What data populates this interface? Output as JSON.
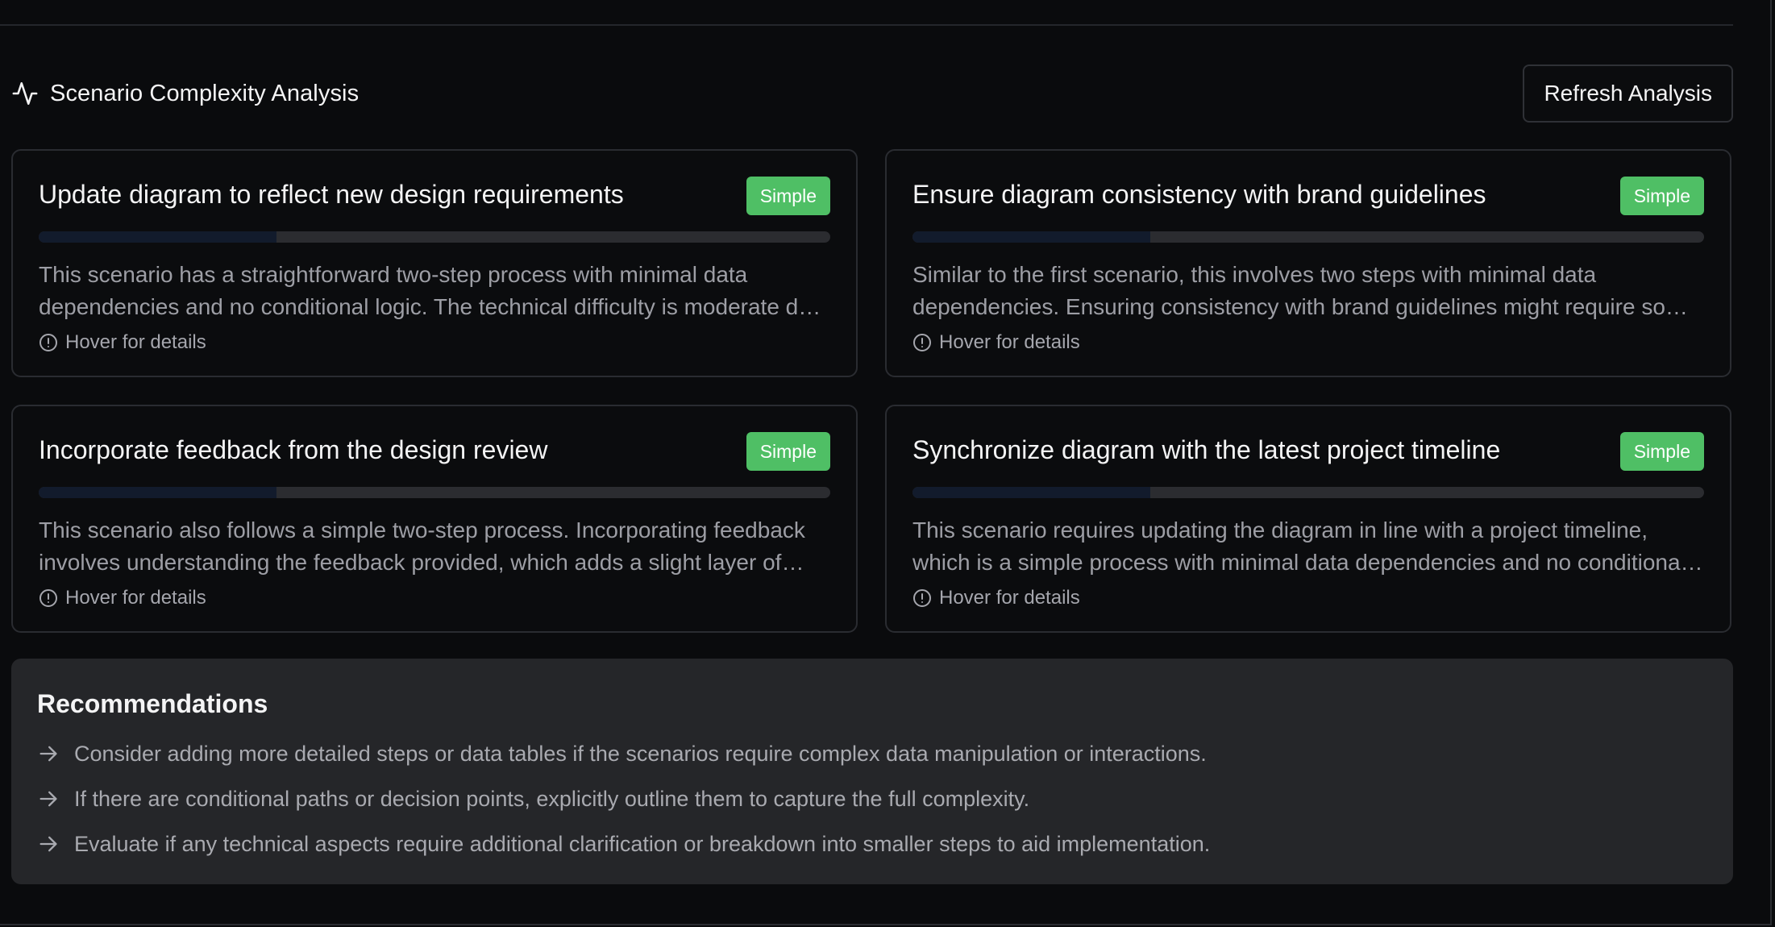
{
  "header": {
    "title": "Scenario Complexity Analysis",
    "refresh_label": "Refresh Analysis",
    "icon": "activity-icon"
  },
  "scenarios": [
    {
      "title": "Update diagram to reflect new design requirements",
      "badge": "Simple",
      "complexity_fraction": 0.3,
      "description": "This scenario has a straightforward two-step process with minimal data dependencies and no conditional logic. The technical difficulty is moderate due to the need for interpreting new design requirements.",
      "hover_label": "Hover for details"
    },
    {
      "title": "Ensure diagram consistency with brand guidelines",
      "badge": "Simple",
      "complexity_fraction": 0.3,
      "description": "Similar to the first scenario, this involves two steps with minimal data dependencies. Ensuring consistency with brand guidelines might require some additional attention to detail.",
      "hover_label": "Hover for details"
    },
    {
      "title": "Incorporate feedback from the design review",
      "badge": "Simple",
      "complexity_fraction": 0.3,
      "description": "This scenario also follows a simple two-step process. Incorporating feedback involves understanding the feedback provided, which adds a slight layer of interpretation.",
      "hover_label": "Hover for details"
    },
    {
      "title": "Synchronize diagram with the latest project timeline",
      "badge": "Simple",
      "complexity_fraction": 0.3,
      "description": "This scenario requires updating the diagram in line with a project timeline, which is a simple process with minimal data dependencies and no conditional logic.",
      "hover_label": "Hover for details"
    }
  ],
  "recommendations": {
    "title": "Recommendations",
    "items": [
      "Consider adding more detailed steps or data tables if the scenarios require complex data manipulation or interactions.",
      "If there are conditional paths or decision points, explicitly outline them to capture the full complexity.",
      "Evaluate if any technical aspects require additional clarification or breakdown into smaller steps to aid implementation."
    ]
  },
  "colors": {
    "background": "#0a0b0d",
    "badge_simple": "#4fbf65",
    "progress_fill": "#121b2c",
    "progress_track": "#2b2c30",
    "recommendations_bg": "#252629"
  }
}
